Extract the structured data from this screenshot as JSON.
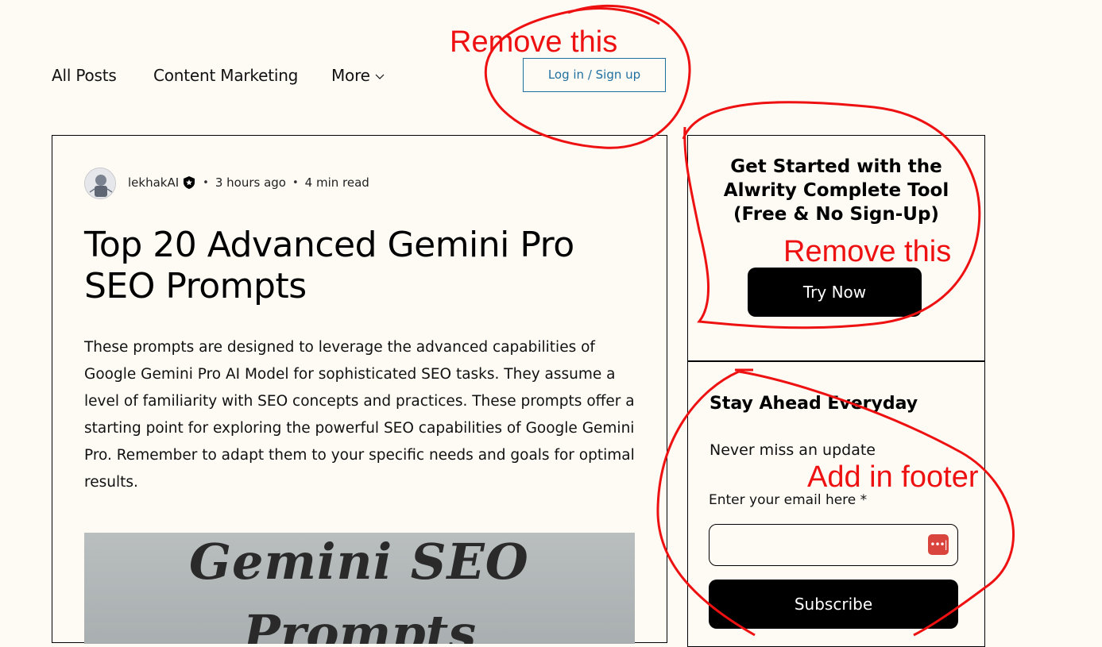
{
  "nav": {
    "items": [
      "All Posts",
      "Content Marketing"
    ],
    "more_label": "More",
    "login_label": "Log in / Sign up"
  },
  "post": {
    "author": "lekhakAI",
    "time_ago": "3 hours ago",
    "read_time": "4 min read",
    "separator": "•",
    "title": "Top 20 Advanced Gemini Pro SEO Prompts",
    "body": "These prompts are designed to leverage the advanced capabilities of Google Gemini Pro AI Model for sophisticated SEO tasks. They assume a level of familiarity with SEO concepts and practices. These prompts offer a starting point for exploring the powerful SEO capabilities of Google Gemini Pro. Remember to adapt them to your specific needs and goals for optimal results.",
    "hero_text": "Gemini SEO",
    "hero_text_2": "Prompts"
  },
  "sidebar": {
    "promo_title": "Get Started with the Alwrity Complete Tool (Free & No Sign-Up)",
    "try_label": "Try Now",
    "stay_title": "Stay Ahead Everyday",
    "never_miss": "Never miss an update",
    "email_label": "Enter your email here *",
    "email_value": "",
    "subscribe_label": "Subscribe"
  },
  "annotations": {
    "remove_1": "Remove this",
    "remove_2": "Remove this",
    "footer": "Add in footer",
    "color": "#ee1111"
  }
}
